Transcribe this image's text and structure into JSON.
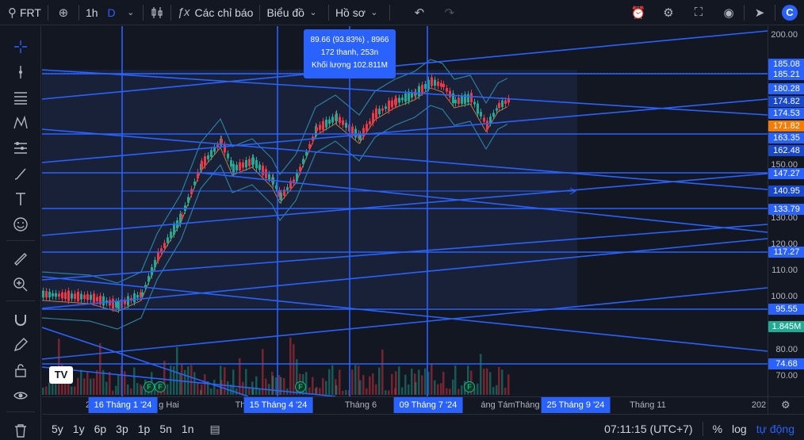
{
  "toolbar": {
    "symbol": "FRT",
    "interval": "1h",
    "style": "D",
    "indicators_label": "Các chỉ báo",
    "chart_label": "Biểu đồ",
    "profile_label": "Hồ sơ"
  },
  "tooltip": {
    "line1": "89.66 (93.83%) , 8966",
    "line2": "172 thanh, 253n",
    "line3": "Khối lượng 102.811M"
  },
  "price_axis": {
    "ticks": [
      "200.00",
      "150.00",
      "130.00",
      "120.00",
      "110.00",
      "100.00",
      "80.00",
      "70.00"
    ],
    "labels": [
      {
        "text": "185.08",
        "color": "#2962ff"
      },
      {
        "text": "185.21",
        "color": "#2962ff"
      },
      {
        "text": "180.28",
        "color": "#2962ff"
      },
      {
        "text": "174.82",
        "color": "#1848cc"
      },
      {
        "text": "174.53",
        "color": "#2962ff"
      },
      {
        "text": "171.82",
        "color": "#f57c00"
      },
      {
        "text": "163.35",
        "color": "#2962ff"
      },
      {
        "text": "162.48",
        "color": "#1848cc"
      },
      {
        "text": "147.27",
        "color": "#2962ff"
      },
      {
        "text": "140.95",
        "color": "#1848cc"
      },
      {
        "text": "133.79",
        "color": "#2962ff"
      },
      {
        "text": "117.27",
        "color": "#2962ff"
      },
      {
        "text": "95.55",
        "color": "#2962ff"
      },
      {
        "text": "1.845M",
        "color": "#22ab94"
      },
      {
        "text": "74.68",
        "color": "#2962ff"
      }
    ]
  },
  "time_axis": {
    "ticks": [
      "2",
      "g Hai",
      "Th",
      "Tháng 6",
      "áng Tám",
      "Tháng",
      "Tháng 11",
      "202"
    ],
    "labels": [
      "16 Tháng 1 '24",
      "15 Tháng 4 '24",
      "09 Tháng 7 '24",
      "25 Tháng 9 '24"
    ]
  },
  "bottom": {
    "ranges": [
      "5y",
      "1y",
      "6p",
      "3p",
      "1p",
      "5n",
      "1n"
    ],
    "time": "07:11:15 (UTC+7)",
    "percent": "%",
    "log": "log",
    "auto": "tự động"
  },
  "flags": [
    "F",
    "F",
    "F",
    "F"
  ],
  "logo_text": "TV",
  "colors": {
    "background": "#131722",
    "accent": "#2962ff",
    "up": "#22ab94",
    "down": "#f23645"
  }
}
